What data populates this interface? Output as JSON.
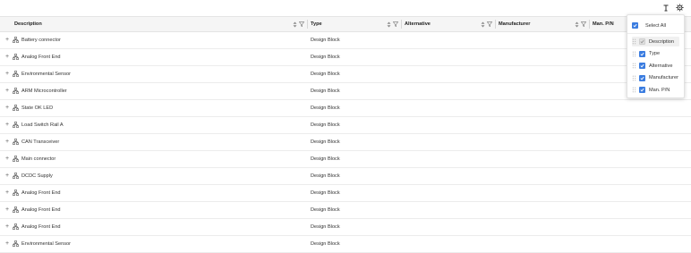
{
  "toolbar": {
    "text_tool_icon": "text-cursor-icon",
    "settings_icon": "gear-icon"
  },
  "columns": {
    "description": "Description",
    "type": "Type",
    "alternative": "Alternative",
    "manufacturer": "Manufacturer",
    "man_pn": "Man. P/N"
  },
  "rows": [
    {
      "description": "Battery connector",
      "type": "Design Block"
    },
    {
      "description": "Analog Front End",
      "type": "Design Block"
    },
    {
      "description": "Environmental Sensor",
      "type": "Design Block"
    },
    {
      "description": "ARM Microcontroller",
      "type": "Design Block"
    },
    {
      "description": "State OK LED",
      "type": "Design Block"
    },
    {
      "description": "Load Switch Rail A",
      "type": "Design Block"
    },
    {
      "description": "CAN Transceiver",
      "type": "Design Block"
    },
    {
      "description": "Main connector",
      "type": "Design Block"
    },
    {
      "description": "DCDC Supply",
      "type": "Design Block"
    },
    {
      "description": "Analog Front End",
      "type": "Design Block"
    },
    {
      "description": "Analog Front End",
      "type": "Design Block"
    },
    {
      "description": "Analog Front End",
      "type": "Design Block"
    },
    {
      "description": "Environmental Sensor",
      "type": "Design Block"
    }
  ],
  "column_panel": {
    "select_all": "Select All",
    "items": [
      {
        "label": "Description",
        "checked": true,
        "disabled": true
      },
      {
        "label": "Type",
        "checked": true,
        "disabled": false
      },
      {
        "label": "Alternative",
        "checked": true,
        "disabled": false
      },
      {
        "label": "Manufacturer",
        "checked": true,
        "disabled": false
      },
      {
        "label": "Man. P/N",
        "checked": true,
        "disabled": false
      }
    ]
  },
  "colors": {
    "accent": "#3a7ce0",
    "header_bg": "#f5f5f5",
    "border": "#e4e4e4"
  }
}
